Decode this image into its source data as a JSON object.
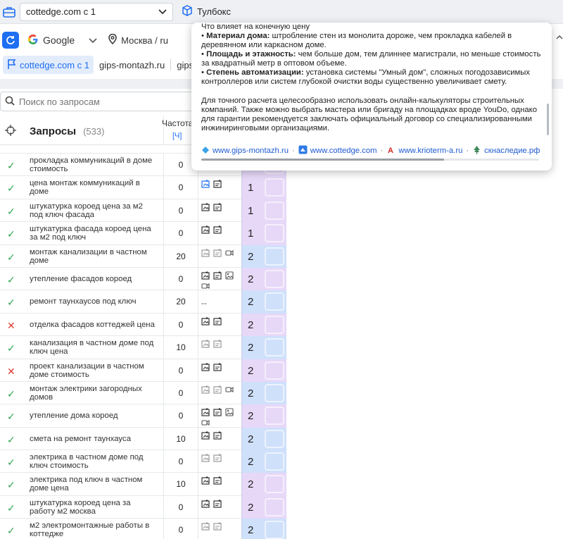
{
  "topbar": {
    "project": "cottedge.com с 1",
    "toolbox": "Тулбокс"
  },
  "bar2": {
    "search_engine": "Google",
    "region": "Москва / ru"
  },
  "sites": {
    "active": "cottedge.com с 1",
    "others": [
      "gips-montazh.ru",
      "gipsm"
    ]
  },
  "search": {
    "placeholder": "Поиск по запросам"
  },
  "table": {
    "title": "Запросы",
    "count": "(533)",
    "freq_header": "Частота",
    "freq_sub": "[Ч]",
    "rows": [
      {
        "status": "ok",
        "query": "прокладка коммуникаций в доме стоимость",
        "freq": "0",
        "icons": [
          "img",
          "gift"
        ],
        "pos": "1",
        "pos_color": "p1"
      },
      {
        "status": "ok",
        "query": "цена монтаж коммуникаций в доме",
        "freq": "0",
        "icons": [
          "img-blue",
          "gift"
        ],
        "pos": "1",
        "pos_color": "p1"
      },
      {
        "status": "ok",
        "query": "штукатурка короед цена за м2 под ключ фасада",
        "freq": "0",
        "icons": [
          "img",
          "gift"
        ],
        "pos": "1",
        "pos_color": "p1"
      },
      {
        "status": "ok",
        "query": "штукатурка фасада короед цена за м2 под ключ",
        "freq": "0",
        "icons": [
          "img",
          "gift"
        ],
        "pos": "1",
        "pos_color": "p1"
      },
      {
        "status": "ok",
        "query": "монтаж канализации в частном доме",
        "freq": "20",
        "icons": [
          "img-light",
          "gift-light",
          "video"
        ],
        "pos": "2",
        "pos_color": "p2"
      },
      {
        "status": "ok",
        "query": "утепление фасадов короед",
        "freq": "0",
        "icons": [
          "img",
          "gift",
          "photo",
          "video"
        ],
        "pos": "2",
        "pos_color": "p2purple"
      },
      {
        "status": "ok",
        "query": "ремонт таунхаусов под ключ",
        "freq": "20",
        "icons": [
          "dash"
        ],
        "pos": "2",
        "pos_color": "p2"
      },
      {
        "status": "bad",
        "query": "отделка фасадов коттеджей цена",
        "freq": "0",
        "icons": [
          "img",
          "gift"
        ],
        "pos": "2",
        "pos_color": "p2purple"
      },
      {
        "status": "ok",
        "query": "канализация в частном доме под ключ цена",
        "freq": "10",
        "icons": [
          "img-light",
          "gift-light"
        ],
        "pos": "2",
        "pos_color": "p2"
      },
      {
        "status": "bad",
        "query": "проект канализации в частном доме стоимость",
        "freq": "0",
        "icons": [
          "img",
          "gift"
        ],
        "pos": "2",
        "pos_color": "p2purple"
      },
      {
        "status": "ok",
        "query": "монтаж электрики загородных домов",
        "freq": "0",
        "icons": [
          "img-light",
          "gift-light",
          "video"
        ],
        "pos": "2",
        "pos_color": "p2"
      },
      {
        "status": "ok",
        "query": "утепление дома короед",
        "freq": "0",
        "icons": [
          "img",
          "gift",
          "photo",
          "video"
        ],
        "pos": "2",
        "pos_color": "p2purple"
      },
      {
        "status": "ok",
        "query": "смета на ремонт таунхауса",
        "freq": "10",
        "icons": [
          "img",
          "gift"
        ],
        "pos": "2",
        "pos_color": "p2"
      },
      {
        "status": "ok",
        "query": "электрика в частном доме под ключ стоимость",
        "freq": "0",
        "icons": [
          "img-light",
          "gift-light"
        ],
        "pos": "2",
        "pos_color": "p2"
      },
      {
        "status": "ok",
        "query": "электрика под ключ в частном доме цена",
        "freq": "10",
        "icons": [
          "img",
          "gift"
        ],
        "pos": "2",
        "pos_color": "p2purple"
      },
      {
        "status": "ok",
        "query": "штукатурка короед цена за работу м2 москва",
        "freq": "0",
        "icons": [
          "img",
          "gift"
        ],
        "pos": "2",
        "pos_color": "p2purple"
      },
      {
        "status": "ok",
        "query": "м2 электромонтажные работы в коттедже",
        "freq": "0",
        "icons": [
          "img-light",
          "gift-light"
        ],
        "pos": "2",
        "pos_color": "p2"
      }
    ]
  },
  "popup": {
    "cut_line": "Что влияет на конечную цену",
    "bullets": [
      {
        "bold": "Материал дома:",
        "text": " штробление стен из монолита дороже, чем прокладка кабелей в деревянном или каркасном доме."
      },
      {
        "bold": "Площадь и этажность:",
        "text": " чем больше дом, тем длиннее магистрали, но меньше стоимость за квадратный метр в оптовом объеме."
      },
      {
        "bold": "Степень автоматизации:",
        "text": " установка системы \"Умный дом\", сложных погодозависимых контроллеров или систем глубокой очистки воды существенно увеличивает смету."
      }
    ],
    "paragraph": "Для точного расчета целесообразно использовать онлайн-калькуляторы строительных компаний. Также можно выбрать мастера или бригаду на площадках вроде YouDo, однако для гарантии рекомендуется заключать официальный договор со специализированными инжиниринговыми организациями.",
    "sources": [
      "www.gips-montazh.ru",
      "www.cottedge.com",
      "www.krioterm-a.ru",
      "скнаследие.рф"
    ]
  }
}
